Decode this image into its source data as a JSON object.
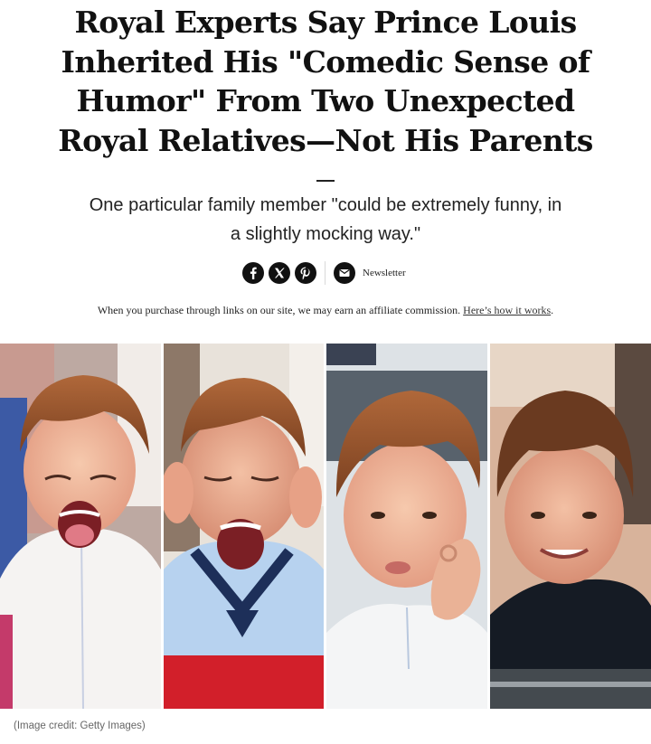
{
  "article": {
    "headline_lines": [
      "Royal Experts Say Prince Louis",
      "Inherited His \"Comedic Sense of",
      "Humor\" From Two Unexpected",
      "Royal Relatives—Not His Parents"
    ],
    "dek_lines": [
      "One particular family member \"could be extremely funny, in",
      "a slightly mocking way.\""
    ]
  },
  "share": {
    "buttons": [
      {
        "icon": "facebook-icon"
      },
      {
        "icon": "x-icon"
      },
      {
        "icon": "pinterest-icon"
      }
    ],
    "newsletter_icon": "envelope-icon",
    "newsletter_label": "Newsletter"
  },
  "affiliate": {
    "text": "When you purchase through links on our site, we may earn an affiliate commission.",
    "link_text": "Here’s how it works",
    "suffix": "."
  },
  "hero": {
    "caption_credit": "(Image credit: Getty Images)",
    "panels": 4
  },
  "colors": {
    "text": "#111111",
    "icon_bg": "#111111",
    "credit": "#666666"
  }
}
